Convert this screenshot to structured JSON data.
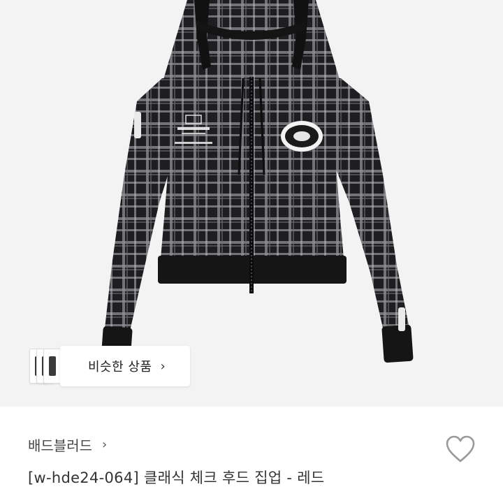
{
  "product": {
    "image_alt": "check hooded zip-up jacket, black and grey plaid",
    "similar_button_label": "비슷한 상품",
    "similar_chevron": "›",
    "brand": "배드블러드",
    "brand_chevron": "›",
    "title": "[w-hde24-064] 클래식 체크 후드 집업 - 레드",
    "wishlist_icon": "heart-outline-icon"
  },
  "colors": {
    "jacket_dark": "#1c1c1e",
    "jacket_check": "#9a9a9e",
    "rib": "#151515",
    "background": "#f3f3f3"
  }
}
